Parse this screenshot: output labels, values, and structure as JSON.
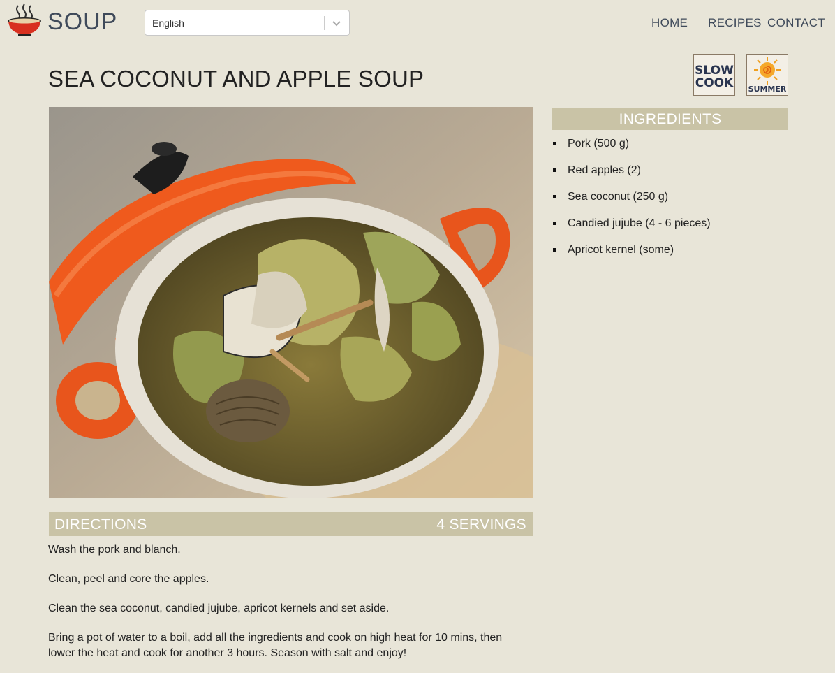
{
  "header": {
    "brand": "SOUP",
    "logo_icon": "soup-bowl-icon",
    "language": {
      "selected": "English",
      "chevron_icon": "chevron-down-icon"
    },
    "nav": [
      {
        "label": "HOME"
      },
      {
        "label": "RECIPES"
      },
      {
        "label": "CONTACT"
      }
    ]
  },
  "recipe": {
    "title": "SEA COCONUT AND APPLE SOUP",
    "badges": [
      {
        "icon": "slow-cook-icon",
        "text": "SLOW COOK"
      },
      {
        "icon": "summer-sun-icon",
        "text": "SUMMER"
      }
    ],
    "photo_icon": "soup-pot-photo",
    "ingredients": {
      "heading": "INGREDIENTS",
      "items": [
        "Pork (500 g)",
        "Red apples (2)",
        "Sea coconut (250 g)",
        "Candied jujube (4 - 6 pieces)",
        "Apricot kernel (some)"
      ]
    },
    "directions": {
      "heading": "DIRECTIONS",
      "servings": "4 SERVINGS",
      "steps": [
        "Wash the pork and blanch.",
        "Clean, peel and core the apples.",
        "Clean the sea coconut, candied jujube, apricot kernels and set aside.",
        "Bring a pot of water to a boil, add all the ingredients and cook on high heat for 10 mins, then lower the heat and cook for another 3 hours. Season with salt and enjoy!"
      ]
    }
  },
  "colors": {
    "background": "#e8e5d8",
    "section_header": "#c9c3a6",
    "nav_text": "#3f4a5a",
    "pot_orange": "#e8551c"
  }
}
